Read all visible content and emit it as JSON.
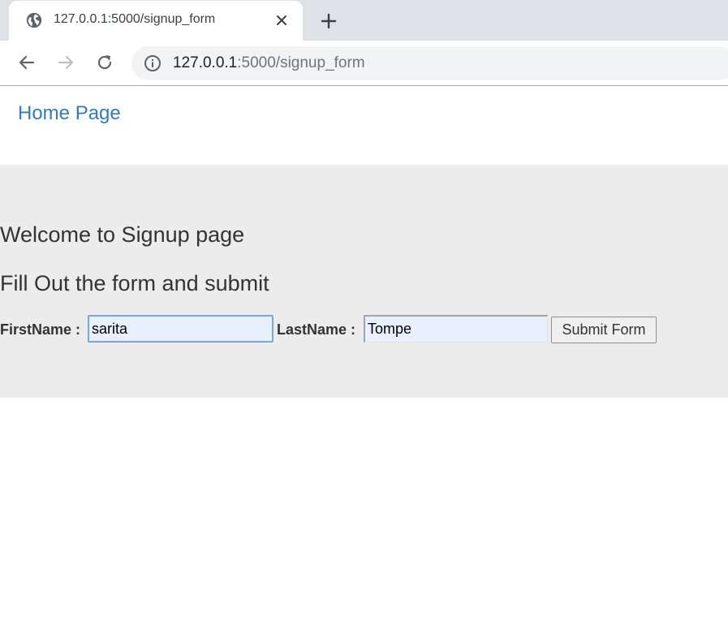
{
  "browser": {
    "tab": {
      "title": "127.0.0.1:5000/signup_form",
      "favicon": "globe-icon"
    },
    "new_tab_icon": "plus-icon",
    "nav": {
      "back_icon": "arrow-left-icon",
      "forward_icon": "arrow-right-icon",
      "reload_icon": "reload-icon"
    },
    "address_bar": {
      "host": "127.0.0.1",
      "rest": ":5000/signup_form",
      "security_icon": "info-icon"
    }
  },
  "page": {
    "nav_link": "Home Page",
    "heading": "Welcome to Signup page",
    "subheading": "Fill Out the form and submit",
    "form": {
      "first_name_label": "FirstName :",
      "first_name_value": "sarita",
      "last_name_label": "LastName :",
      "last_name_value": "Tompe",
      "submit_label": "Submit Form"
    }
  },
  "colors": {
    "link": "#337ab7",
    "jumbotron_bg": "#ececec",
    "autofill_bg": "#e8f0fe",
    "tabstrip_bg": "#dee1e6"
  }
}
